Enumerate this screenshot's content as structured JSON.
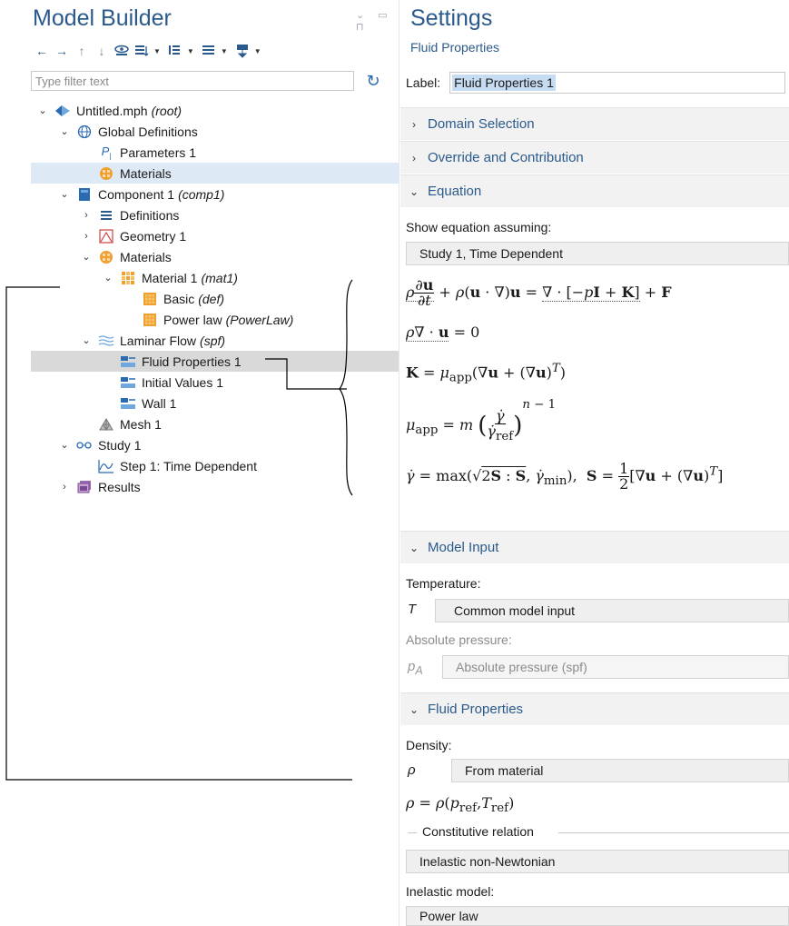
{
  "model_builder": {
    "title": "Model Builder",
    "window_controls": "⌄ ▭ ⊓",
    "filter_placeholder": "Type filter text",
    "tree": [
      {
        "label": "Untitled.mph",
        "suffix": "(root)",
        "icon": "model-root-icon",
        "level": 0,
        "chevron": "⌄"
      },
      {
        "label": "Global Definitions",
        "suffix": "",
        "icon": "globe-icon",
        "level": 1,
        "chevron": "⌄"
      },
      {
        "label": "Parameters 1",
        "suffix": "",
        "icon": "parameters-icon",
        "level": 2,
        "chevron": ""
      },
      {
        "label": "Materials",
        "suffix": "",
        "icon": "materials-icon",
        "level": 2,
        "chevron": "",
        "selected": "light"
      },
      {
        "label": "Component 1",
        "suffix": "(comp1)",
        "icon": "component-icon",
        "level": 1,
        "chevron": "⌄"
      },
      {
        "label": "Definitions",
        "suffix": "",
        "icon": "definitions-icon",
        "level": 2,
        "chevron": "›"
      },
      {
        "label": "Geometry 1",
        "suffix": "",
        "icon": "geometry-icon",
        "level": 2,
        "chevron": "›"
      },
      {
        "label": "Materials",
        "suffix": "",
        "icon": "materials-icon",
        "level": 2,
        "chevron": "⌄"
      },
      {
        "label": "Material 1",
        "suffix": "(mat1)",
        "icon": "material-icon",
        "level": 3,
        "chevron": "⌄"
      },
      {
        "label": "Basic",
        "suffix": "(def)",
        "icon": "property-group-icon",
        "level": 4,
        "chevron": ""
      },
      {
        "label": "Power law",
        "suffix": "(PowerLaw)",
        "icon": "property-group-icon",
        "level": 4,
        "chevron": ""
      },
      {
        "label": "Laminar Flow",
        "suffix": "(spf)",
        "icon": "laminar-flow-icon",
        "level": 2,
        "chevron": "⌄"
      },
      {
        "label": "Fluid Properties 1",
        "suffix": "",
        "icon": "domain-feature-icon",
        "level": 3,
        "chevron": "",
        "selected": "gray"
      },
      {
        "label": "Initial Values 1",
        "suffix": "",
        "icon": "domain-feature-icon",
        "level": 3,
        "chevron": ""
      },
      {
        "label": "Wall 1",
        "suffix": "",
        "icon": "boundary-feature-icon",
        "level": 3,
        "chevron": ""
      },
      {
        "label": "Mesh 1",
        "suffix": "",
        "icon": "mesh-icon",
        "level": 2,
        "chevron": ""
      },
      {
        "label": "Study 1",
        "suffix": "",
        "icon": "study-icon",
        "level": 1,
        "chevron": "⌄"
      },
      {
        "label": "Step 1: Time Dependent",
        "suffix": "",
        "icon": "time-dependent-icon",
        "level": 2,
        "chevron": ""
      },
      {
        "label": "Results",
        "suffix": "",
        "icon": "results-icon",
        "level": 1,
        "chevron": "›"
      }
    ]
  },
  "settings": {
    "title": "Settings",
    "subtitle": "Fluid Properties",
    "label_name": "Label:",
    "label_value": "Fluid Properties 1",
    "sections": {
      "domain_selection": "Domain Selection",
      "override": "Override and Contribution",
      "equation": "Equation",
      "model_input": "Model Input",
      "fluid_properties": "Fluid Properties"
    },
    "equation": {
      "show_label": "Show equation assuming:",
      "study_value": "Study 1, Time Dependent"
    },
    "model_input": {
      "temperature_label": "Temperature:",
      "temperature_symbol": "T",
      "temperature_value": "Common model input",
      "pressure_label": "Absolute pressure:",
      "pressure_symbol": "pA",
      "pressure_value": "Absolute pressure (spf)"
    },
    "fluid_properties": {
      "density_label": "Density:",
      "density_symbol": "ρ",
      "density_value": "From material",
      "constitutive_label": "Constitutive relation",
      "constitutive_value": "Inelastic non-Newtonian",
      "inelastic_label": "Inelastic model:",
      "inelastic_value": "Power law"
    }
  },
  "colors": {
    "accent_blue": "#2a5a8c",
    "selection_light": "#dde9f5",
    "selection_gray": "#d9d9d9",
    "material_orange": "#f0a030"
  }
}
